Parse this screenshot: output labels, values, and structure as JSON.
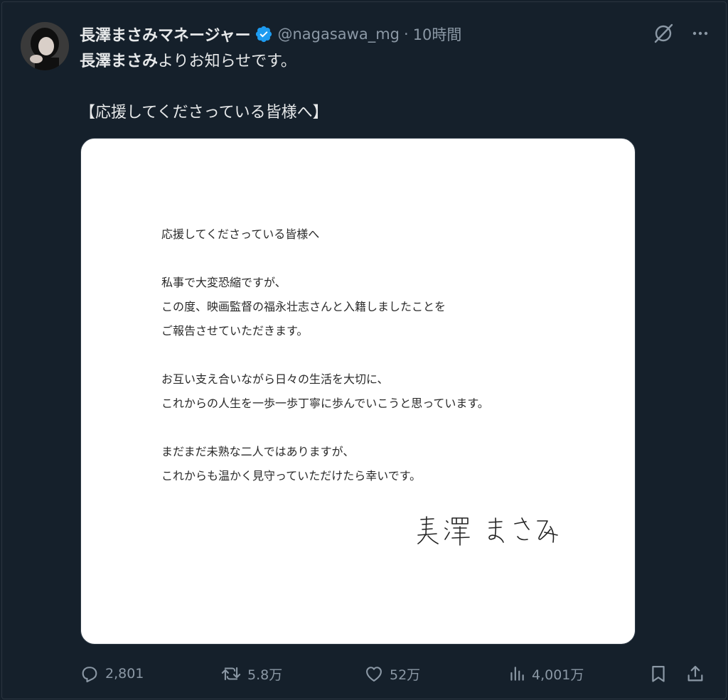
{
  "author": {
    "display_name": "長澤まさみマネージャー",
    "handle": "@nagasawa_mg",
    "time": "10時間",
    "verified": true
  },
  "tweet": {
    "line1_bold": "長澤まさみ",
    "line1_rest": "よりお知らせです。",
    "line2": "【応援してくださっている皆様へ】"
  },
  "letter": {
    "greeting": "応援してくださっている皆様へ",
    "p1_l1": "私事で大変恐縮ですが、",
    "p1_l2": "この度、映画監督の福永壮志さんと入籍しましたことを",
    "p1_l3": "ご報告させていただきます。",
    "p2_l1": "お互い支え合いながら日々の生活を大切に、",
    "p2_l2": "これからの人生を一歩一歩丁寧に歩んでいこうと思っています。",
    "p3_l1": "まだまだ未熟な二人ではありますが、",
    "p3_l2": "これからも温かく見守っていただけたら幸いです。",
    "signature": "長澤 まさみ"
  },
  "actions": {
    "replies": "2,801",
    "retweets": "5.8万",
    "likes": "52万",
    "views": "4,001万"
  },
  "colors": {
    "background": "#15202b",
    "text": "#e7e9ea",
    "muted": "#8b98a5",
    "verified": "#1d9bf0"
  },
  "icons": [
    "grok-icon",
    "more-icon",
    "reply-icon",
    "retweet-icon",
    "like-icon",
    "views-icon",
    "bookmark-icon",
    "share-icon",
    "verified-badge-icon"
  ]
}
